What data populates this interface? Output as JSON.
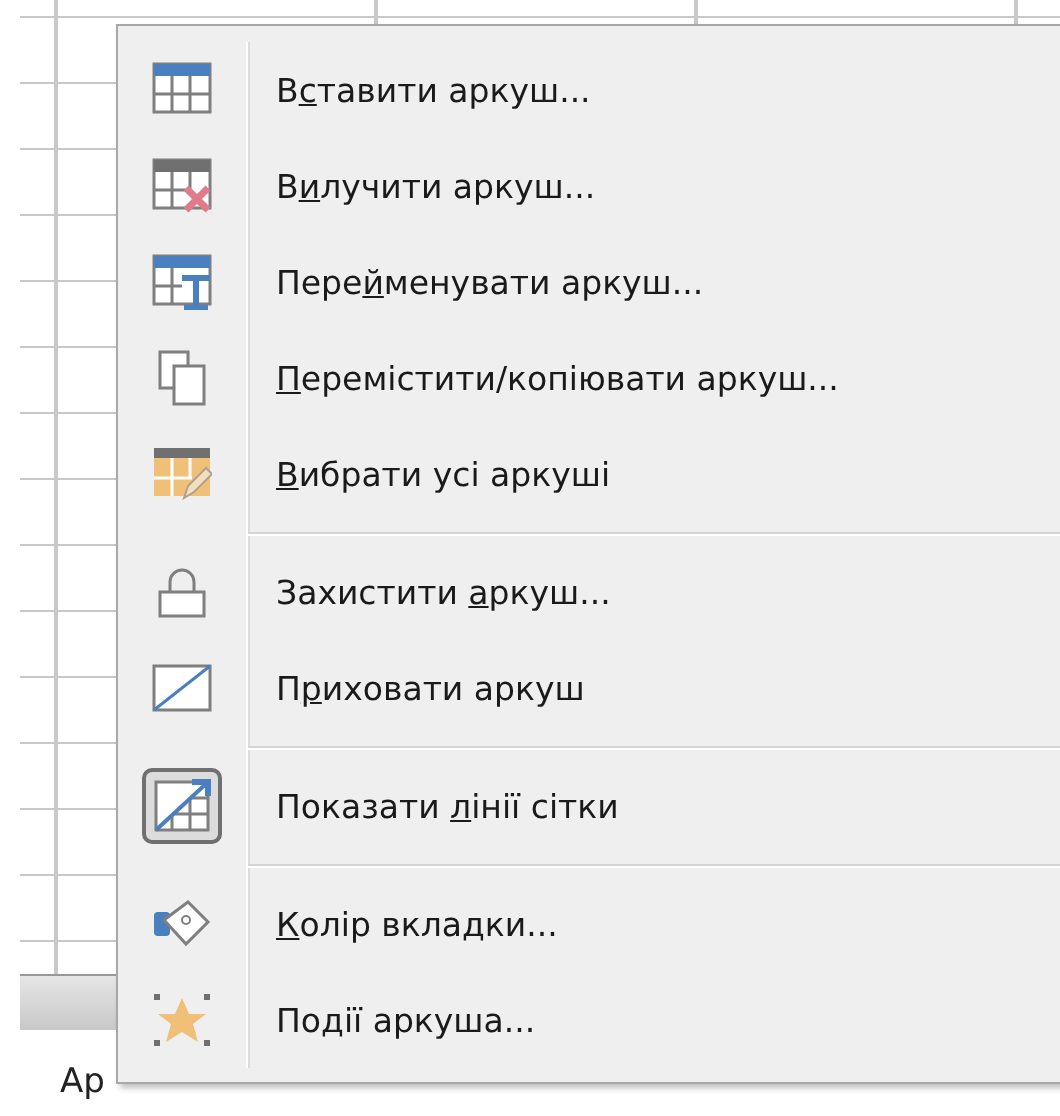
{
  "sheet_tabs": [
    {
      "label": "Ар"
    }
  ],
  "context_menu": {
    "sections": [
      {
        "items": [
          {
            "label": {
              "before": "В",
              "key": "с",
              "after": "тавити аркуш..."
            },
            "checked": false
          },
          {
            "label": {
              "before": "В",
              "key": "и",
              "after": "лучити аркуш..."
            },
            "checked": false
          },
          {
            "label": {
              "before": "Пере",
              "key": "й",
              "after": "менувати аркуш..."
            },
            "checked": false
          },
          {
            "label": {
              "key": "П",
              "after": "еремістити/копіювати аркуш..."
            },
            "checked": false
          },
          {
            "label": {
              "key": "В",
              "after": "ибрати усі аркуші"
            },
            "checked": false
          }
        ]
      },
      {
        "items": [
          {
            "label": {
              "before": "Захистити ",
              "key": "а",
              "after": "ркуш..."
            },
            "checked": false
          },
          {
            "label": {
              "before": "П",
              "key": "р",
              "after": "иховати аркуш"
            },
            "checked": false
          }
        ]
      },
      {
        "items": [
          {
            "label": {
              "before": "Показати ",
              "key": "л",
              "after": "інії сітки"
            },
            "checked": true
          }
        ]
      },
      {
        "items": [
          {
            "label": {
              "key": "К",
              "after": "олір вкладки..."
            },
            "checked": false
          },
          {
            "label": {
              "before": "По",
              "key": "д",
              "after": "ії аркуша..."
            },
            "checked": false
          }
        ]
      }
    ]
  }
}
